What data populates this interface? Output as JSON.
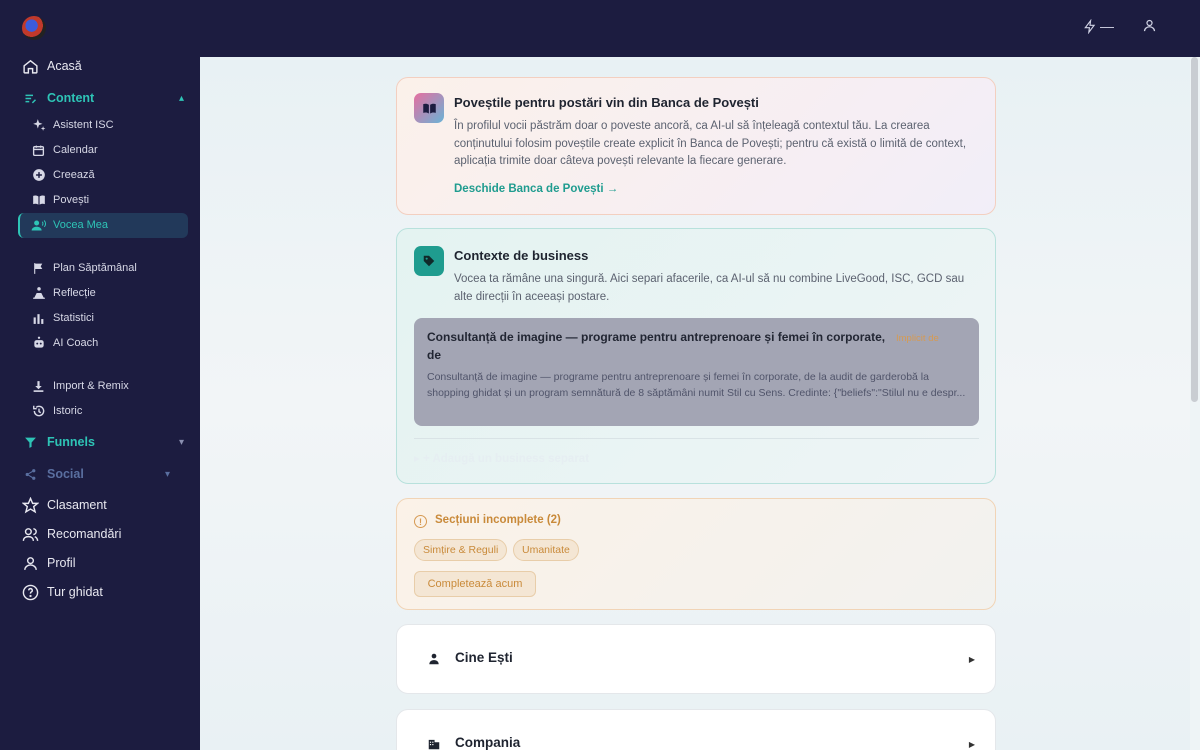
{
  "sidebar": {
    "home": "Acasă",
    "content_section": "Content",
    "content_items": [
      "Asistent ISC",
      "Calendar",
      "Creează",
      "Povești",
      "Vocea Mea"
    ],
    "plan_items": [
      "Plan Săptămânal",
      "Reflecție",
      "Statistici",
      "AI Coach"
    ],
    "tools_items": [
      "Import & Remix",
      "Istoric"
    ],
    "funnels_section": "Funnels",
    "social_section": "Social",
    "bottom_items": [
      "Clasament",
      "Recomandări",
      "Profil",
      "Tur ghidat"
    ]
  },
  "topbar": {
    "bolt_label": "—"
  },
  "stories_card": {
    "title": "Poveștile pentru postări vin din Banca de Povești",
    "text": "În profilul vocii păstrăm doar o poveste ancoră, ca AI-ul să înțeleagă contextul tău. La crearea conținutului folosim poveștile create explicit în Banca de Povești; pentru că există o limită de context, aplicația trimite doar câteva povești relevante la fiecare generare.",
    "link": "Deschide Banca de Povești →"
  },
  "business_card": {
    "title": "Contexte de business",
    "text": "Vocea ta rămâne una singură. Aici separi afacerile, ca AI-ul să nu combine LiveGood, ISC, GCD sau alte direcții în aceeași postare.",
    "item_title": "Consultanță de imagine — programe pentru antreprenoare și femei în corporate, de",
    "item_tag": "Implicit de",
    "item_desc": "Consultanță de imagine — programe pentru antreprenoare și femei în corporate, de la audit de garderobă la shopping ghidat și un program semnătură de 8 săptămâni numit Stil cu Sens. Credinte: {\"beliefs\":\"Stilul nu e despr...",
    "add_label": "▸ + Adaugă un business separat"
  },
  "incomplete_card": {
    "title": "Secțiuni incomplete (2)",
    "chips": [
      "Simțire & Reguli",
      "Umanitate"
    ],
    "button": "Completează acum"
  },
  "accordions": [
    "Cine Ești",
    "Compania"
  ],
  "colors": {
    "sidebar_bg": "#1c1c40",
    "accent": "#2ec4b6",
    "warning": "#c98a3a"
  }
}
